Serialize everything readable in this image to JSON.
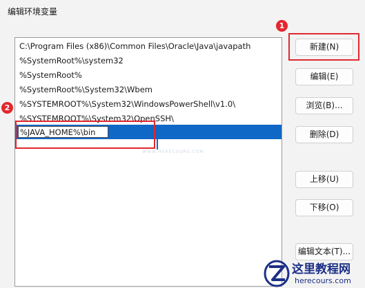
{
  "dialog": {
    "title": "编辑环境变量"
  },
  "path_list": {
    "items": [
      "C:\\Program Files (x86)\\Common Files\\Oracle\\Java\\javapath",
      "%SystemRoot%\\system32",
      "%SystemRoot%",
      "%SystemRoot%\\System32\\Wbem",
      "%SYSTEMROOT%\\System32\\WindowsPowerShell\\v1.0\\",
      "%SYSTEMROOT%\\System32\\OpenSSH\\"
    ],
    "editing_value": "%JAVA_HOME%\\bin"
  },
  "buttons": {
    "new": "新建(N)",
    "edit": "编辑(E)",
    "browse": "浏览(B)...",
    "delete": "删除(D)",
    "move_up": "上移(U)",
    "move_down": "下移(O)",
    "edit_text": "编辑文本(T)..."
  },
  "annotations": {
    "step1": "1",
    "step2": "2"
  },
  "watermark": {
    "faint_text": "WWW.HERECOURS.COM",
    "brand_name": "这里教程网",
    "brand_url": "herecours.com"
  },
  "colors": {
    "selection": "#0f67c6",
    "annotation_red": "#e0272d",
    "brand_blue": "#1c2f86"
  }
}
